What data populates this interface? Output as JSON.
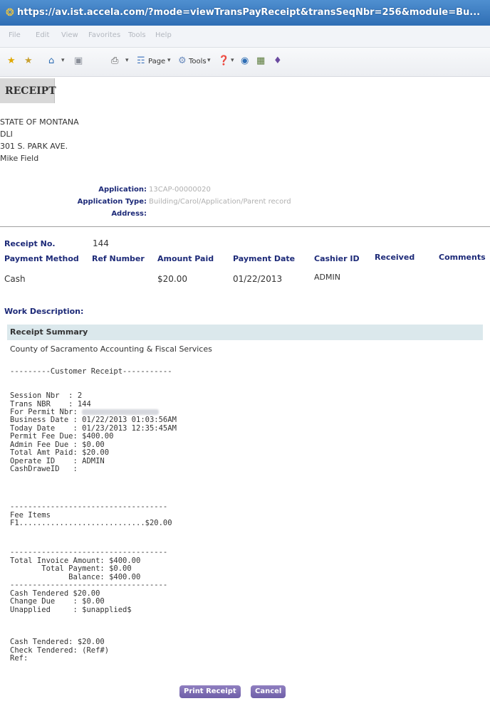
{
  "window": {
    "title": "https://av.ist.accela.com/?mode=viewTransPayReceipt&transSeqNbr=256&module=Bu..."
  },
  "menu": [
    "File",
    "Edit",
    "View",
    "Favorites",
    "Tools",
    "Help"
  ],
  "toolbar": {
    "page_label": "Page",
    "tools_label": "Tools"
  },
  "header": {
    "title": "RECEIPT"
  },
  "address": [
    "STATE OF MONTANA",
    "DLI",
    "301 S. PARK AVE.",
    "Mike Field"
  ],
  "application": {
    "application_label": "Application:",
    "application_value": "13CAP-00000020",
    "type_label": "Application Type:",
    "type_value": "Building/Carol/Application/Parent record",
    "address_label": "Address:"
  },
  "receipt": {
    "label": "Receipt No.",
    "value": "144"
  },
  "payment_table": {
    "columns": [
      "Payment Method",
      "Ref Number",
      "Amount Paid",
      "Payment Date",
      "Cashier ID",
      "Received",
      "Comments"
    ],
    "rows": [
      [
        "Cash",
        "",
        "$20.00",
        "01/22/2013",
        "ADMIN",
        "",
        ""
      ]
    ]
  },
  "work_description_label": "Work Description:",
  "summary": {
    "title": "Receipt Summary",
    "subtitle": "County of Sacramento Accounting & Fiscal Services",
    "divider_title": "---------Customer Receipt-----------",
    "session_block": "Session Nbr  : 2\nTrans NBR    : 144",
    "permit_label": "For Permit Nbr: ",
    "dates_block": "Business Date : 01/22/2013 01:03:56AM\nToday Date    : 01/23/2013 12:35:45AM\nPermit Fee Due: $400.00\nAdmin Fee Due : $0.00\nTotal Amt Paid: $20.00\nOperate ID    : ADMIN\nCashDraweID   :",
    "fee_block": "-----------------------------------\nFee Items\nF1............................$20.00",
    "totals_block": "-----------------------------------\nTotal Invoice Amount: $400.00\n       Total Payment: $0.00\n             Balance: $400.00\n-----------------------------------\nCash Tendered $20.00\nChange Due    : $0.00\nUnapplied     : $unapplied$",
    "tender_block": "Cash Tendered: $20.00\nCheck Tendered: (Ref#)\nRef:"
  },
  "buttons": {
    "print": "Print Receipt",
    "cancel": "Cancel"
  }
}
